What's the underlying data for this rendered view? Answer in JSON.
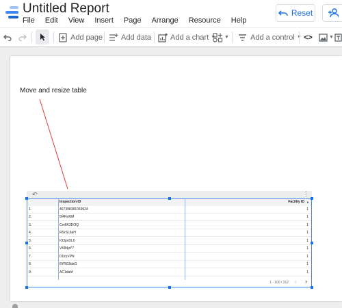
{
  "app": {
    "title": "Untitled Report",
    "menu": [
      "File",
      "Edit",
      "View",
      "Insert",
      "Page",
      "Arrange",
      "Resource",
      "Help"
    ],
    "reset_label": "Reset"
  },
  "toolbar": {
    "add_page": "Add page",
    "add_data": "Add data",
    "add_chart": "Add a chart",
    "add_control": "Add a control",
    "code_symbol": "<>"
  },
  "canvas": {
    "annotation": "Move and resize table"
  },
  "table": {
    "columns": [
      "Inspection ID",
      "Facility ID"
    ],
    "sort_indicator": "▼",
    "rows": [
      {
        "n": "1.",
        "a": "467398381069924",
        "b": "1"
      },
      {
        "n": "2.",
        "a": "5f4FsXtM",
        "b": "1"
      },
      {
        "n": "3.",
        "a": "Cm6K3DOQ",
        "b": "1"
      },
      {
        "n": "4.",
        "a": "RSrSL6aH",
        "b": "1"
      },
      {
        "n": "5.",
        "a": "IO3pvDL0",
        "b": "1"
      },
      {
        "n": "6.",
        "a": "VK84pY7",
        "b": "1"
      },
      {
        "n": "7.",
        "a": "DUryVPN",
        "b": "1"
      },
      {
        "n": "8.",
        "a": "8YRG9dxG",
        "b": "1"
      },
      {
        "n": "9.",
        "a": "AC1dahf",
        "b": "1"
      }
    ],
    "pagination": "1 - 100 / 312"
  },
  "colors": {
    "accent": "#1a73e8",
    "annotation_line": "#e53935",
    "logo_blue": "#4285f4",
    "logo_light": "#a1c2fa"
  }
}
